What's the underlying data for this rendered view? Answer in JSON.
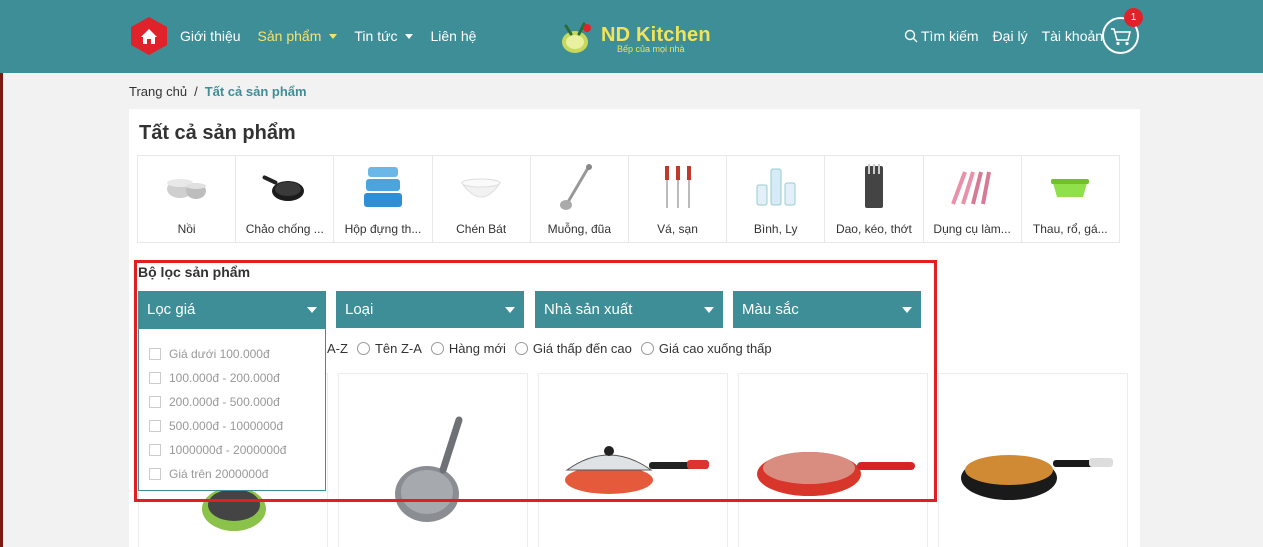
{
  "colors": {
    "header_bg": "#3e8e98",
    "accent_yellow": "#f7e36b",
    "badge_red": "#e0222a",
    "highlight_red": "#e02020"
  },
  "nav": {
    "items": [
      {
        "label": "Giới thiệu",
        "has_caret": false,
        "active": false
      },
      {
        "label": "Sản phẩm",
        "has_caret": true,
        "active": true
      },
      {
        "label": "Tin tức",
        "has_caret": true,
        "active": false
      },
      {
        "label": "Liên hệ",
        "has_caret": false,
        "active": false
      }
    ]
  },
  "logo": {
    "name": "ND Kitchen",
    "tagline": "Bếp của mọi nhà"
  },
  "right_nav": {
    "search": "Tìm kiếm",
    "dealer": "Đại lý",
    "account": "Tài khoản",
    "cart_count": "1"
  },
  "breadcrumb": {
    "home": "Trang chủ",
    "separator": "/",
    "current": "Tất cả sản phẩm"
  },
  "page_title": "Tất cả sản phẩm",
  "categories": [
    {
      "label": "Nồi",
      "icon": "pot-icon"
    },
    {
      "label": "Chảo chống ...",
      "icon": "pan-icon"
    },
    {
      "label": "Hộp đựng th...",
      "icon": "container-icon"
    },
    {
      "label": "Chén Bát",
      "icon": "bowl-icon"
    },
    {
      "label": "Muỗng, đũa",
      "icon": "ladle-icon"
    },
    {
      "label": "Vá, sạn",
      "icon": "utensils-icon"
    },
    {
      "label": "Bình, Ly",
      "icon": "glass-icon"
    },
    {
      "label": "Dao, kéo, thớt",
      "icon": "knife-icon"
    },
    {
      "label": "Dụng cụ làm...",
      "icon": "tools-icon"
    },
    {
      "label": "Thau, rổ, gá...",
      "icon": "basket-icon"
    }
  ],
  "filter": {
    "title": "Bộ lọc sản phẩm",
    "buttons": [
      "Lọc giá",
      "Loại",
      "Nhà sản xuất",
      "Màu sắc"
    ],
    "price_options": [
      "Giá dưới 100.000đ",
      "100.000đ - 200.000đ",
      "200.000đ - 500.000đ",
      "500.000đ - 1000000đ",
      "1000000đ - 2000000đ",
      "Giá trên 2000000đ"
    ],
    "sort_partial": "A-Z",
    "sort_options": [
      "Tên Z-A",
      "Hàng mới",
      "Giá thấp đến cao",
      "Giá cao xuống thấp"
    ]
  },
  "products": [
    {
      "icon": "green-pan-icon"
    },
    {
      "icon": "grey-pan-icon"
    },
    {
      "icon": "lidded-pan-icon"
    },
    {
      "icon": "red-pan-icon"
    },
    {
      "icon": "copper-wok-icon"
    }
  ]
}
